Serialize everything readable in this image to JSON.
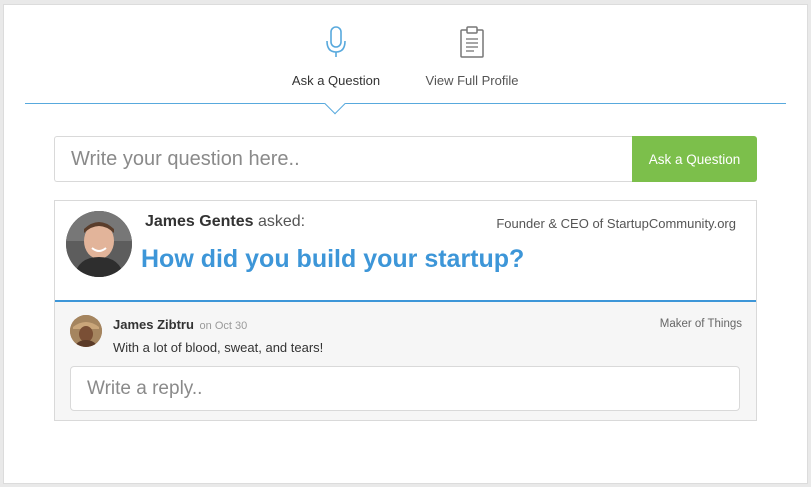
{
  "tabs": {
    "ask": {
      "label": "Ask a Question",
      "icon": "microphone-icon"
    },
    "profile": {
      "label": "View Full Profile",
      "icon": "clipboard-icon"
    }
  },
  "ask_form": {
    "placeholder": "Write your question here..",
    "button_label": "Ask a Question"
  },
  "question": {
    "asker_name": "James Gentes",
    "asked_label": "asked:",
    "asker_title": "Founder & CEO of StartupCommunity.org",
    "text": "How did you build your startup?"
  },
  "answer": {
    "author_name": "James Zibtru",
    "date": "on Oct 30",
    "author_title": "Maker of Things",
    "text": "With a lot of blood, sweat, and tears!"
  },
  "reply_form": {
    "placeholder": "Write a reply.."
  },
  "colors": {
    "accent_blue": "#3d96d8",
    "button_green": "#7cbf4b",
    "icon_blue": "#58a9dd"
  }
}
